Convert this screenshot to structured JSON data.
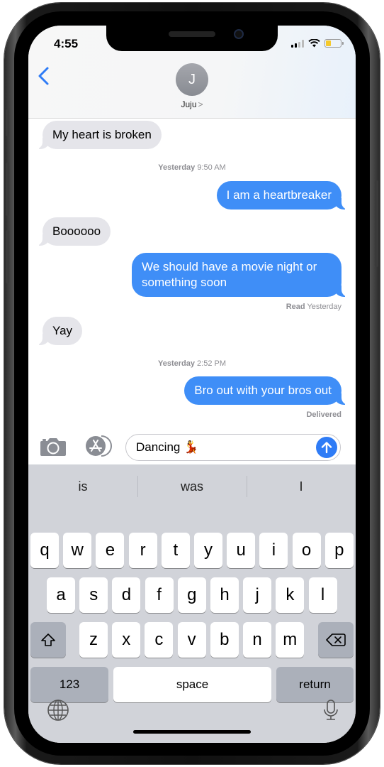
{
  "status_bar": {
    "time": "4:55",
    "signal_bars_active": 2,
    "signal_bars_total": 4,
    "battery_level": 0.35,
    "battery_color": "#f5c92b"
  },
  "header": {
    "back_icon": "chevron-left-icon",
    "avatar_initial": "J",
    "contact_name": "Juju",
    "contact_chevron": ">"
  },
  "messages": [
    {
      "type": "bubble",
      "direction": "incoming",
      "text": "My heart is broken"
    },
    {
      "type": "timestamp",
      "day": "Yesterday",
      "time": "9:50 AM"
    },
    {
      "type": "bubble",
      "direction": "outgoing",
      "text": "I am a heartbreaker"
    },
    {
      "type": "bubble",
      "direction": "incoming",
      "text": "Boooooo"
    },
    {
      "type": "bubble",
      "direction": "outgoing",
      "text": "We should have a movie night or something soon"
    },
    {
      "type": "receipt",
      "status": "Read",
      "detail": "Yesterday"
    },
    {
      "type": "bubble",
      "direction": "incoming",
      "text": "Yay"
    },
    {
      "type": "timestamp",
      "day": "Yesterday",
      "time": "2:52 PM"
    },
    {
      "type": "bubble",
      "direction": "outgoing",
      "text": "Bro out with your bros out"
    },
    {
      "type": "receipt",
      "status": "Delivered",
      "detail": ""
    }
  ],
  "composer": {
    "camera_icon": "camera-icon",
    "apps_icon": "app-store-icon",
    "text_value": "Dancing 💃",
    "send_icon": "arrow-up-icon"
  },
  "colors": {
    "outgoing_bubble": "#3f8ef7",
    "incoming_bubble": "#e5e5ea",
    "accent": "#2f7cf6"
  },
  "keyboard": {
    "suggestions": [
      "is",
      "was",
      "I"
    ],
    "row1": [
      "q",
      "w",
      "e",
      "r",
      "t",
      "y",
      "u",
      "i",
      "o",
      "p"
    ],
    "row2": [
      "a",
      "s",
      "d",
      "f",
      "g",
      "h",
      "j",
      "k",
      "l"
    ],
    "row3": [
      "z",
      "x",
      "c",
      "v",
      "b",
      "n",
      "m"
    ],
    "shift_icon": "shift-icon",
    "delete_icon": "delete-icon",
    "numbers_label": "123",
    "space_label": "space",
    "return_label": "return",
    "globe_icon": "globe-icon",
    "mic_icon": "microphone-icon"
  }
}
